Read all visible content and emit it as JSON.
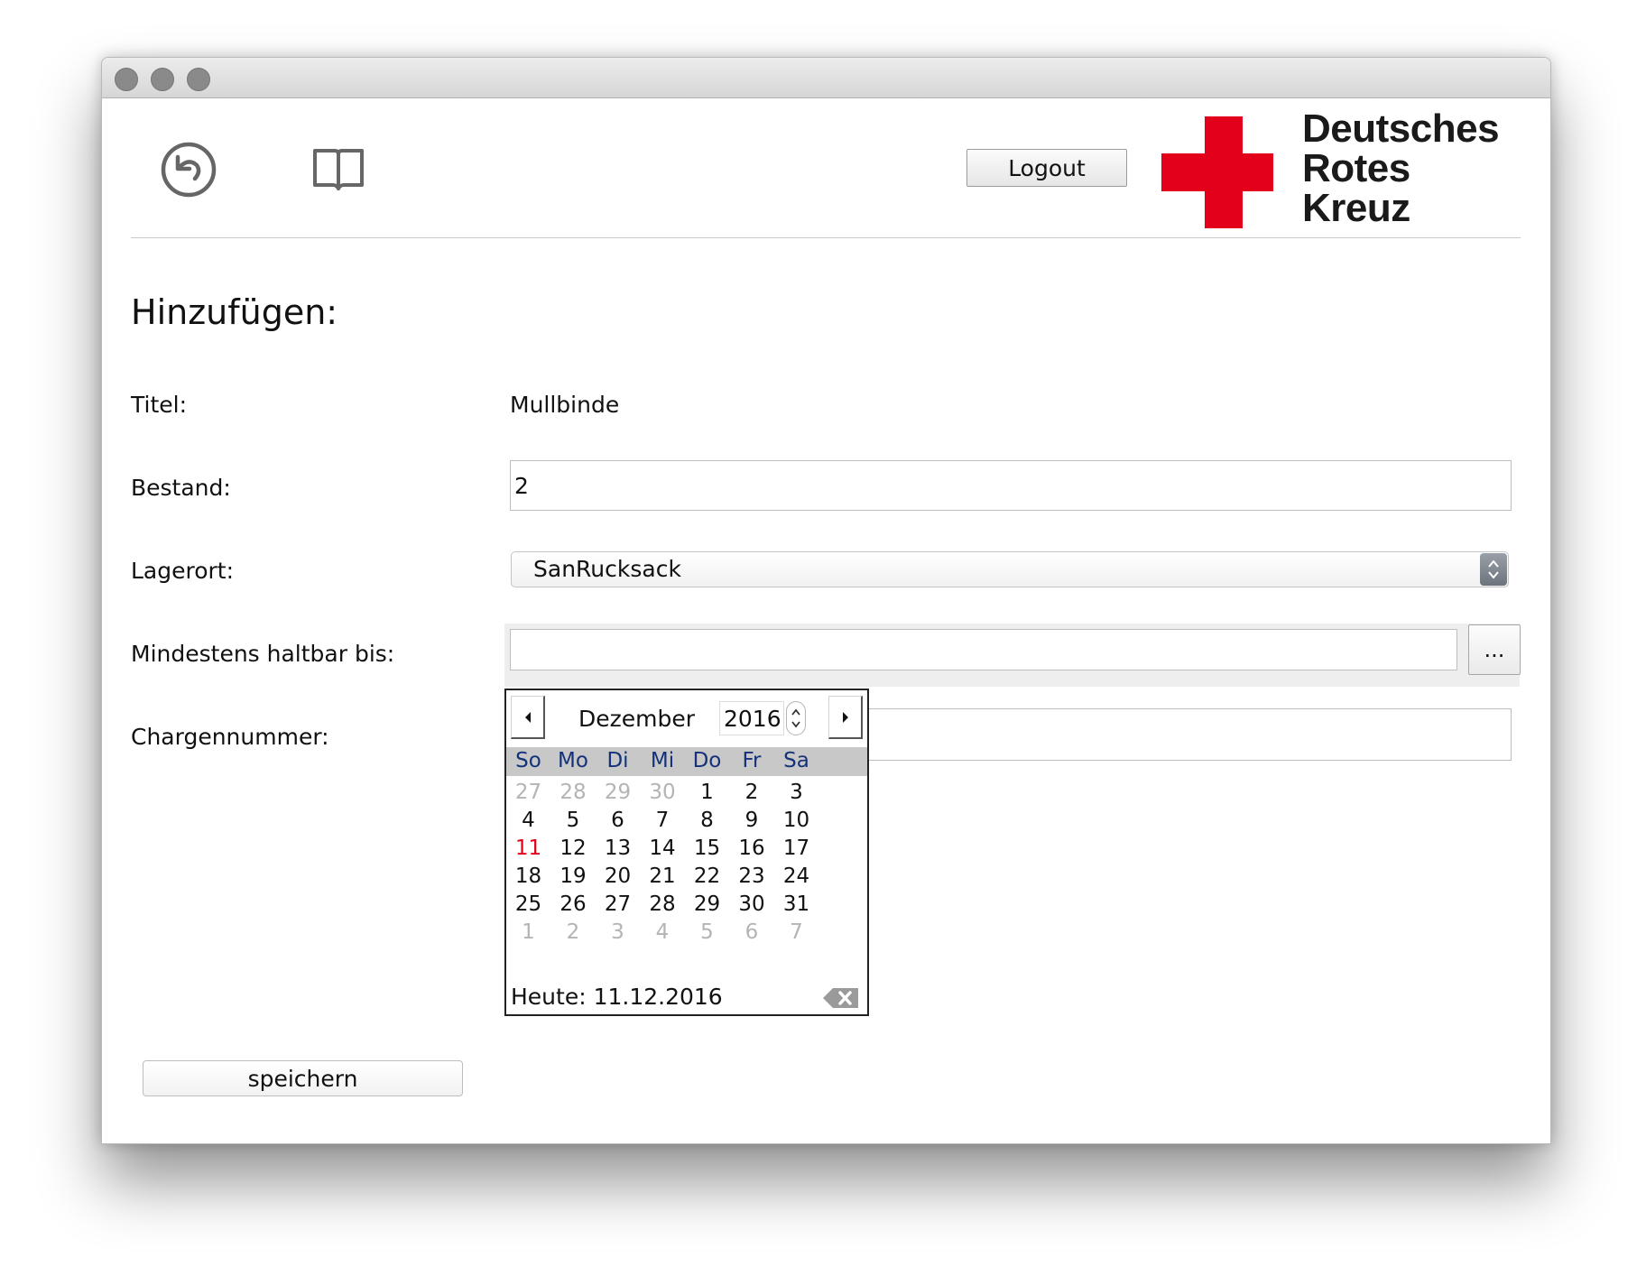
{
  "window": {
    "traffic_lights": [
      "close",
      "minimize",
      "zoom"
    ]
  },
  "toolbar": {
    "back_icon": "back-arrow-circle-icon",
    "book_icon": "open-book-icon",
    "logout_label": "Logout"
  },
  "logo": {
    "lines": [
      "Deutsches",
      "Rotes",
      "Kreuz"
    ],
    "cross_color": "#e2001a"
  },
  "form": {
    "heading": "Hinzufügen:",
    "titel_label": "Titel:",
    "titel_value": "Mullbinde",
    "bestand_label": "Bestand:",
    "bestand_value": "2",
    "lagerort_label": "Lagerort:",
    "lagerort_value": "SanRucksack",
    "mhd_label": "Mindestens haltbar bis:",
    "mhd_value": "",
    "mhd_button_label": "...",
    "charge_label": "Chargennummer:",
    "charge_value": "",
    "save_label": "speichern"
  },
  "calendar": {
    "month": "Dezember",
    "year": "2016",
    "weekdays": [
      "So",
      "Mo",
      "Di",
      "Mi",
      "Do",
      "Fr",
      "Sa"
    ],
    "weeks": [
      [
        "27",
        "28",
        "29",
        "30",
        "1",
        "2",
        "3"
      ],
      [
        "4",
        "5",
        "6",
        "7",
        "8",
        "9",
        "10"
      ],
      [
        "11",
        "12",
        "13",
        "14",
        "15",
        "16",
        "17"
      ],
      [
        "18",
        "19",
        "20",
        "21",
        "22",
        "23",
        "24"
      ],
      [
        "25",
        "26",
        "27",
        "28",
        "29",
        "30",
        "31"
      ],
      [
        "1",
        "2",
        "3",
        "4",
        "5",
        "6",
        "7"
      ]
    ],
    "muted_days": [
      [
        0,
        0
      ],
      [
        0,
        1
      ],
      [
        0,
        2
      ],
      [
        0,
        3
      ],
      [
        5,
        0
      ],
      [
        5,
        1
      ],
      [
        5,
        2
      ],
      [
        5,
        3
      ],
      [
        5,
        4
      ],
      [
        5,
        5
      ],
      [
        5,
        6
      ]
    ],
    "today_cell": [
      2,
      0
    ],
    "today_text": "Heute: 11.12.2016",
    "today_color": "#e2001a",
    "weekday_color": "#14317a"
  }
}
